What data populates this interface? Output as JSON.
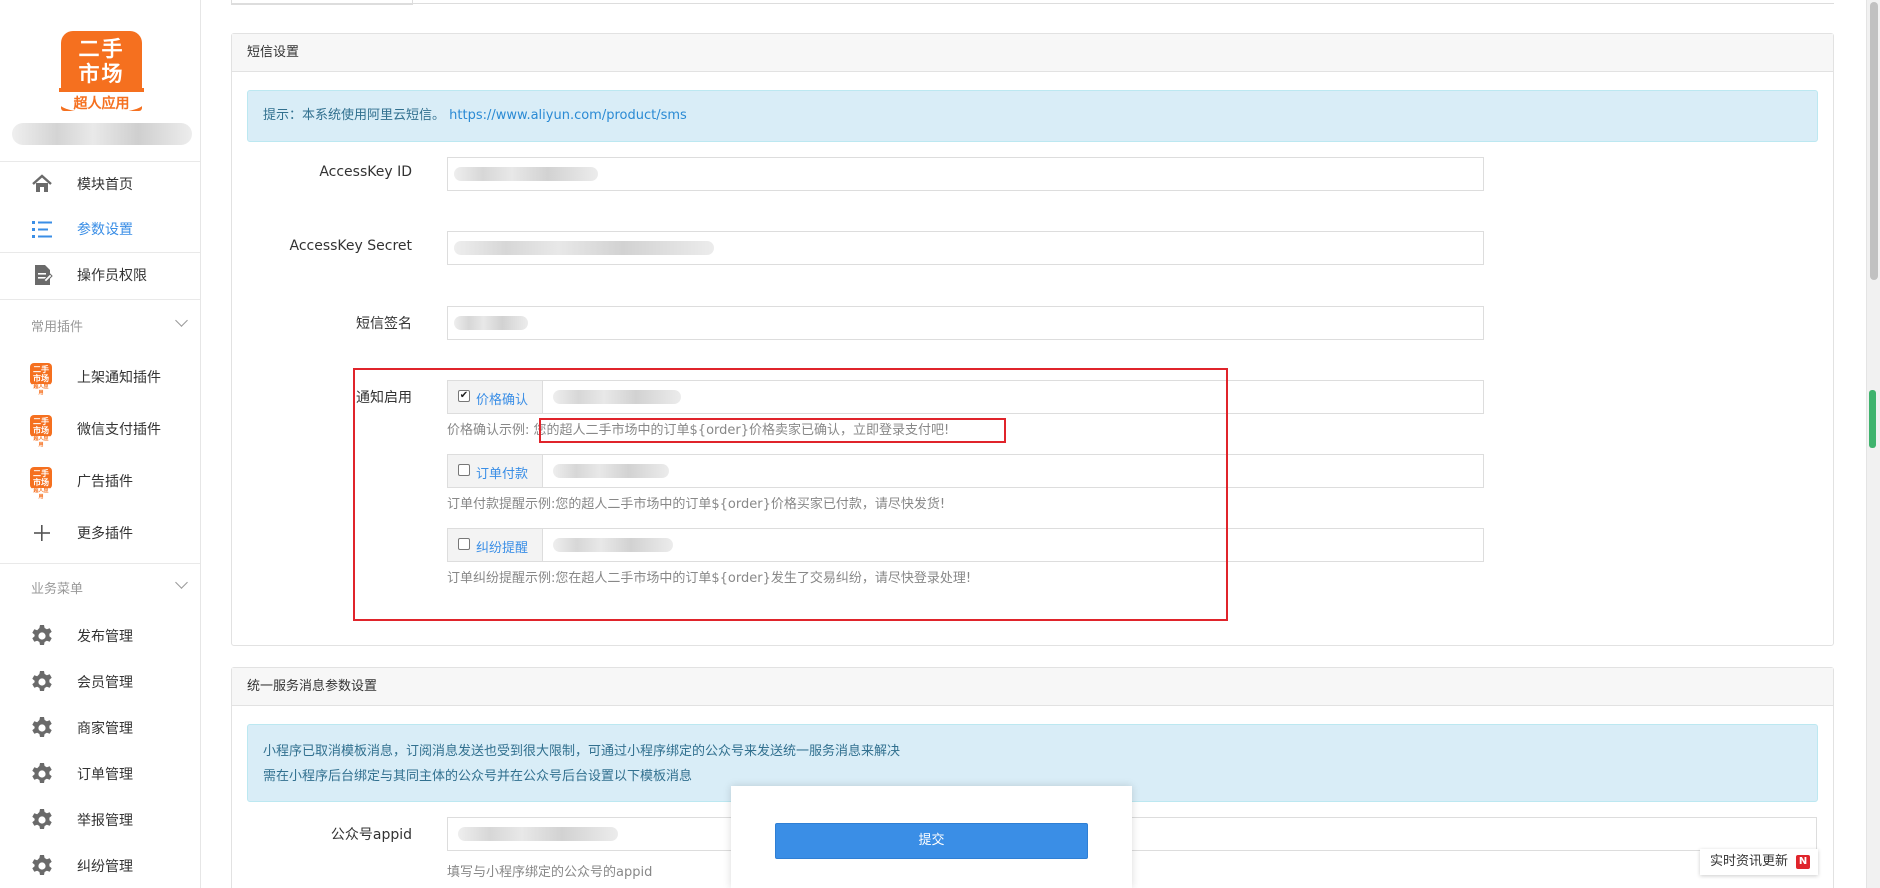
{
  "sidebar": {
    "logo": {
      "line1": "二手",
      "line2": "市场",
      "sub": "超人应用"
    },
    "nav": [
      {
        "label": "模块首页",
        "icon": "home-icon"
      },
      {
        "label": "参数设置",
        "icon": "list-icon",
        "active": true
      },
      {
        "label": "操作员权限",
        "icon": "document-icon"
      }
    ],
    "plugins_group": {
      "title": "常用插件",
      "items": [
        {
          "label": "上架通知插件",
          "icon": "plugin-logo-icon"
        },
        {
          "label": "微信支付插件",
          "icon": "plugin-logo-icon"
        },
        {
          "label": "广告插件",
          "icon": "plugin-logo-icon"
        },
        {
          "label": "更多插件",
          "icon": "plus-icon"
        }
      ]
    },
    "business_group": {
      "title": "业务菜单",
      "items": [
        {
          "label": "发布管理",
          "icon": "gear-icon"
        },
        {
          "label": "会员管理",
          "icon": "gear-icon"
        },
        {
          "label": "商家管理",
          "icon": "gear-icon"
        },
        {
          "label": "订单管理",
          "icon": "gear-icon"
        },
        {
          "label": "举报管理",
          "icon": "gear-icon"
        },
        {
          "label": "纠纷管理",
          "icon": "gear-icon"
        }
      ]
    }
  },
  "sms_panel": {
    "title": "短信设置",
    "alert_text": "提示：本系统使用阿里云短信。",
    "alert_link": "https://www.aliyun.com/product/sms",
    "access_key_id_label": "AccessKey ID",
    "access_key_secret_label": "AccessKey Secret",
    "sign_label": "短信签名",
    "notify_label": "通知启用",
    "notifications": [
      {
        "label": "价格确认",
        "checked": true,
        "hint_prefix": "价格确认示例:",
        "hint": "您的超人二手市场中的订单${order}价格卖家已确认，立即登录支付吧!"
      },
      {
        "label": "订单付款",
        "checked": false,
        "hint_prefix": "订单付款提醒示例:",
        "hint": "您的超人二手市场中的订单${order}价格买家已付款，请尽快发货!"
      },
      {
        "label": "纠纷提醒",
        "checked": false,
        "hint_prefix": "订单纠纷提醒示例:",
        "hint": "您在超人二手市场中的订单${order}发生了交易纠纷，请尽快登录处理!"
      }
    ]
  },
  "service_panel": {
    "title": "统一服务消息参数设置",
    "alert_line1": "小程序已取消模板消息，订阅消息发送也受到很大限制，可通过小程序绑定的公众号来发送统一服务消息来解决",
    "alert_line2": "需在小程序后台绑定与其同主体的公众号并在公众号后台设置以下模板消息",
    "appid_label": "公众号appid",
    "appid_hint": "填写与小程序绑定的公众号的appid"
  },
  "submit_label": "提交",
  "news_badge": {
    "label": "实时资讯更新",
    "badge": "N"
  },
  "colors": {
    "accent": "#3a8ee6",
    "brand": "#f5701f",
    "highlight": "#e0242b"
  }
}
